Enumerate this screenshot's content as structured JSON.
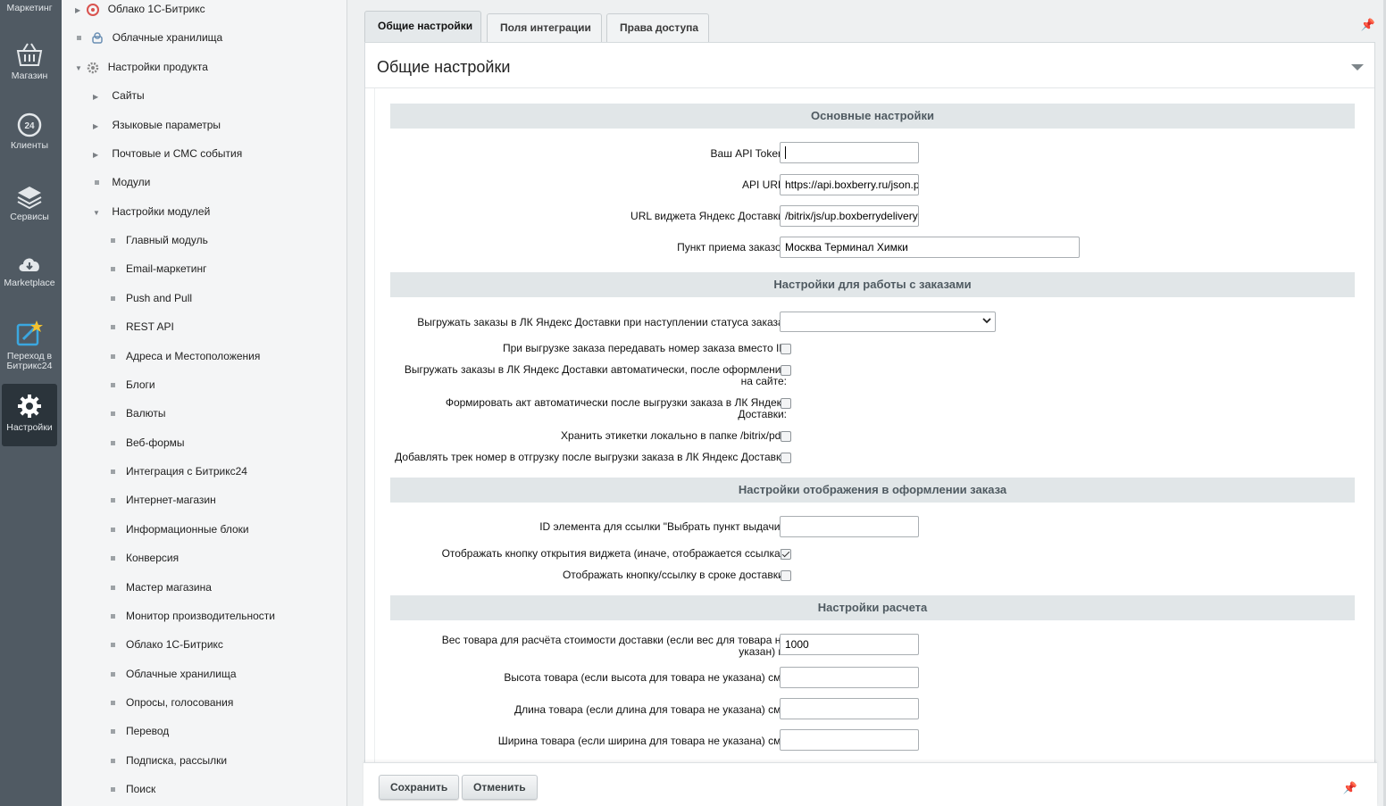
{
  "left_menu": {
    "items": [
      {
        "label": "Маркетинг",
        "icon": "marketing-icon"
      },
      {
        "label": "Магазин",
        "icon": "basket-icon"
      },
      {
        "label": "Клиенты",
        "icon": "clients-24-icon"
      },
      {
        "label": "Сервисы",
        "icon": "layers-icon"
      },
      {
        "label": "Marketplace",
        "icon": "cloud-download-icon"
      },
      {
        "label": "Переход в Битрикс24",
        "icon": "bitrix24-edit-icon"
      },
      {
        "label": "Настройки",
        "icon": "gear-icon",
        "active": true
      }
    ]
  },
  "tree": {
    "items": [
      {
        "label": "Облако 1С-Битрикс",
        "level": 0,
        "kind": "arrow-right",
        "icon": "cloud-bitrix-icon"
      },
      {
        "label": "Облачные хранилища",
        "level": 0,
        "kind": "dot",
        "icon": "cloud-storage-icon"
      },
      {
        "label": "Настройки продукта",
        "level": 0,
        "kind": "arrow-down",
        "icon": "settings-gear-icon"
      },
      {
        "label": "Сайты",
        "level": 1,
        "kind": "arrow-right"
      },
      {
        "label": "Языковые параметры",
        "level": 1,
        "kind": "arrow-right"
      },
      {
        "label": "Почтовые и СМС события",
        "level": 1,
        "kind": "arrow-right"
      },
      {
        "label": "Модули",
        "level": 1,
        "kind": "dot"
      },
      {
        "label": "Настройки модулей",
        "level": 1,
        "kind": "arrow-down"
      },
      {
        "label": "Главный модуль",
        "level": 2,
        "kind": "dot"
      },
      {
        "label": "Email-маркетинг",
        "level": 2,
        "kind": "dot"
      },
      {
        "label": "Push and Pull",
        "level": 2,
        "kind": "dot"
      },
      {
        "label": "REST API",
        "level": 2,
        "kind": "dot"
      },
      {
        "label": "Адреса и Местоположения",
        "level": 2,
        "kind": "dot"
      },
      {
        "label": "Блоги",
        "level": 2,
        "kind": "dot"
      },
      {
        "label": "Валюты",
        "level": 2,
        "kind": "dot"
      },
      {
        "label": "Веб-формы",
        "level": 2,
        "kind": "dot"
      },
      {
        "label": "Интеграция с Битрикс24",
        "level": 2,
        "kind": "dot"
      },
      {
        "label": "Интернет-магазин",
        "level": 2,
        "kind": "dot"
      },
      {
        "label": "Информационные блоки",
        "level": 2,
        "kind": "dot"
      },
      {
        "label": "Конверсия",
        "level": 2,
        "kind": "dot"
      },
      {
        "label": "Мастер магазина",
        "level": 2,
        "kind": "dot"
      },
      {
        "label": "Монитор производительности",
        "level": 2,
        "kind": "dot"
      },
      {
        "label": "Облако 1С-Битрикс",
        "level": 2,
        "kind": "dot"
      },
      {
        "label": "Облачные хранилища",
        "level": 2,
        "kind": "dot"
      },
      {
        "label": "Опросы, голосования",
        "level": 2,
        "kind": "dot"
      },
      {
        "label": "Перевод",
        "level": 2,
        "kind": "dot"
      },
      {
        "label": "Подписка, рассылки",
        "level": 2,
        "kind": "dot"
      },
      {
        "label": "Поиск",
        "level": 2,
        "kind": "dot"
      }
    ]
  },
  "tabs": [
    {
      "label": "Общие настройки",
      "active": true
    },
    {
      "label": "Поля интеграции",
      "active": false
    },
    {
      "label": "Права доступа",
      "active": false
    }
  ],
  "card": {
    "title": "Общие настройки"
  },
  "sections": {
    "basic": "Основные настройки",
    "orders": "Настройки для работы с заказами",
    "display": "Настройки отображения в оформлении заказа",
    "calc": "Настройки расчета"
  },
  "fields": {
    "api_token": {
      "label": "Ваш API Token:",
      "value": ""
    },
    "api_url": {
      "label": "API URL:",
      "value": "https://api.boxberry.ru/json.p"
    },
    "widget_url": {
      "label": "URL виджета Яндекс Доставки:",
      "value": "/bitrix/js/up.boxberrydelivery"
    },
    "pickup_point": {
      "label": "Пункт приема заказов",
      "value": "Москва Терминал Химки"
    },
    "export_status": {
      "label": "Выгружать заказы в ЛК Яндекс Доставки при наступлении статуса заказа:",
      "value": ""
    },
    "pass_order_number": {
      "label": "При выгрузке заказа передавать номер заказа вместо ID",
      "checked": false
    },
    "auto_export": {
      "label": "Выгружать заказы в ЛК Яндекс Доставки автоматически, после оформления на сайте:",
      "checked": false
    },
    "auto_act": {
      "label": "Формировать акт автоматически после выгрузки заказа в ЛК Яндекс Доставки:",
      "checked": false
    },
    "store_labels": {
      "label": "Хранить этикетки локально в папке /bitrix/pdf:",
      "checked": false
    },
    "add_track": {
      "label": "Добавлять трек номер в отгрузку после выгрузки заказа в ЛК Яндекс Доставки",
      "checked": false
    },
    "element_id": {
      "label": "ID элемента для ссылки \"Выбрать пункт выдачи\":",
      "value": ""
    },
    "widget_button": {
      "label": "Отображать кнопку открытия виджета (иначе, отображается ссылка):",
      "checked": true
    },
    "delivery_time_button": {
      "label": "Отображать кнопку/ссылку в сроке доставки:",
      "checked": false
    },
    "weight": {
      "label": "Вес товара для расчёта стоимости доставки (если вес для товара не указан) г.:",
      "value": "1000"
    },
    "height": {
      "label": "Высота товара (если высота для товара не указана) см.:",
      "value": ""
    },
    "length": {
      "label": "Длина товара (если длина для товара не указана) см.:",
      "value": ""
    },
    "width": {
      "label": "Ширина товара (если ширина для товара не указана) см.:",
      "value": ""
    }
  },
  "footer": {
    "save_label": "Сохранить",
    "cancel_label": "Отменить"
  }
}
